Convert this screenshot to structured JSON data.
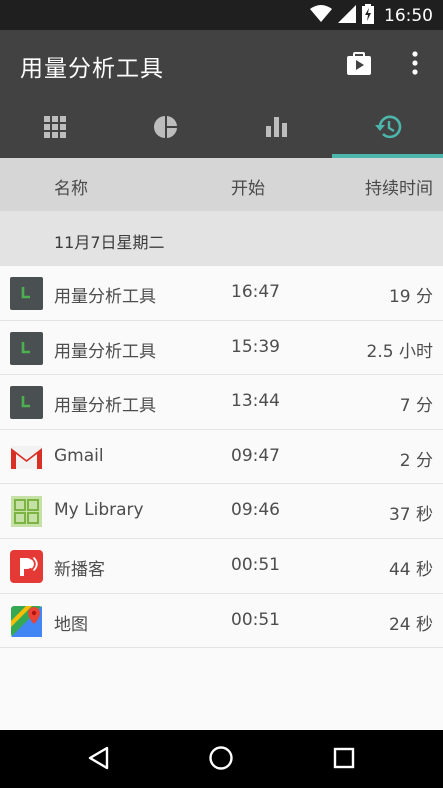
{
  "status_bar": {
    "time": "16:50",
    "icons": [
      "wifi-icon",
      "cell-signal-icon",
      "battery-charging-icon"
    ]
  },
  "app_bar": {
    "title": "用量分析工具",
    "actions": [
      "play-store-icon",
      "more-vert-icon"
    ]
  },
  "tabs": [
    {
      "icon": "grid-icon",
      "selected": false
    },
    {
      "icon": "pie-chart-icon",
      "selected": false
    },
    {
      "icon": "bar-chart-icon",
      "selected": false
    },
    {
      "icon": "history-icon",
      "selected": true
    }
  ],
  "colors": {
    "app_bar": "#424242",
    "accent": "#4db6ac",
    "header_bg": "#d6d6d6",
    "group_bg": "#e3e3e3"
  },
  "table": {
    "headers": {
      "name": "名称",
      "start": "开始",
      "duration": "持续时间"
    },
    "group_date": "11月7日星期二",
    "rows": [
      {
        "icon": "usage-analyzer-icon",
        "name": "用量分析工具",
        "start": "16:47",
        "duration": "19 分"
      },
      {
        "icon": "usage-analyzer-icon",
        "name": "用量分析工具",
        "start": "15:39",
        "duration": "2.5 小时"
      },
      {
        "icon": "usage-analyzer-icon",
        "name": "用量分析工具",
        "start": "13:44",
        "duration": "7 分"
      },
      {
        "icon": "gmail-icon",
        "name": "Gmail",
        "start": "09:47",
        "duration": "2 分"
      },
      {
        "icon": "my-library-icon",
        "name": "My Library",
        "start": "09:46",
        "duration": "37 秒"
      },
      {
        "icon": "podcast-icon",
        "name": "新播客",
        "start": "00:51",
        "duration": "44 秒"
      },
      {
        "icon": "maps-icon",
        "name": "地图",
        "start": "00:51",
        "duration": "24 秒"
      }
    ]
  },
  "nav_bar": [
    "back-icon",
    "home-icon",
    "recents-icon"
  ]
}
